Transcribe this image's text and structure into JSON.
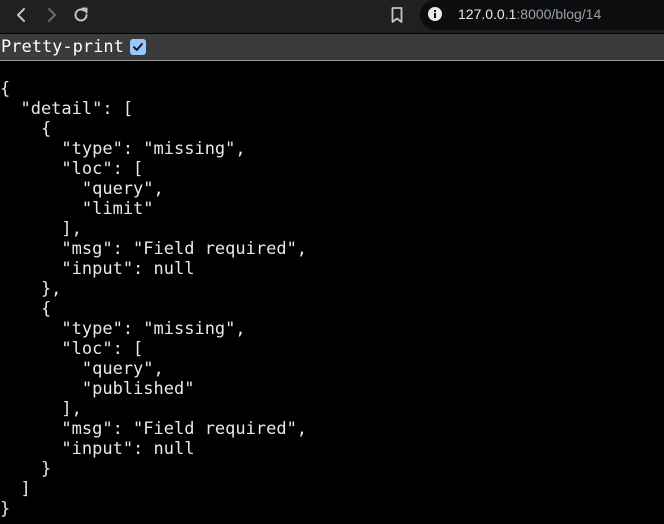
{
  "browser": {
    "url_host": "127.0.0.1",
    "url_rest": ":8000/blog/14",
    "icons": {
      "back": "arrow-left-icon",
      "forward": "arrow-right-icon",
      "reload": "reload-icon",
      "bookmark": "bookmark-icon",
      "site_info": "info-circle-icon"
    }
  },
  "pretty_print": {
    "label": "Pretty-print",
    "checked": true
  },
  "json_lines": [
    "{",
    "  \"detail\": [",
    "    {",
    "      \"type\": \"missing\",",
    "      \"loc\": [",
    "        \"query\",",
    "        \"limit\"",
    "      ],",
    "      \"msg\": \"Field required\",",
    "      \"input\": null",
    "    },",
    "    {",
    "      \"type\": \"missing\",",
    "      \"loc\": [",
    "        \"query\",",
    "        \"published\"",
    "      ],",
    "      \"msg\": \"Field required\",",
    "      \"input\": null",
    "    }",
    "  ]",
    "}"
  ],
  "colors": {
    "page_background": "#000000",
    "toolbar_background": "#1f2021",
    "omnibox_background": "#0c0d0e",
    "pretty_print_bar": "#3b3b3b",
    "checkbox_accent": "#99c8ff",
    "text": "#e8e8e8"
  }
}
